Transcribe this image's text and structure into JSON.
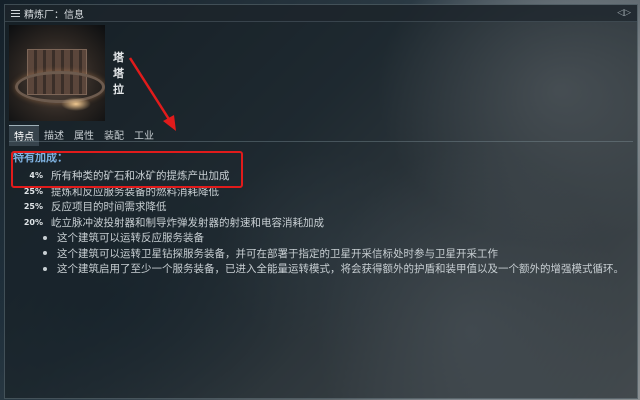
{
  "window": {
    "title": "精炼厂：信息"
  },
  "item": {
    "name": "塔塔拉"
  },
  "tabs": [
    {
      "label": "特点",
      "active": true
    },
    {
      "label": "描述"
    },
    {
      "label": "属性"
    },
    {
      "label": "装配"
    },
    {
      "label": "工业"
    }
  ],
  "traits": {
    "section_title": "特有加成：",
    "bonuses": [
      {
        "value": "4%",
        "text": "所有种类的矿石和冰矿的提炼产出加成"
      },
      {
        "value": "25%",
        "text": "提炼和反应服务装备的燃料消耗降低"
      },
      {
        "value": "25%",
        "text": "反应项目的时间需求降低"
      },
      {
        "value": "20%",
        "text": "屹立脉冲波投射器和制导炸弹发射器的射速和电容消耗加成"
      }
    ],
    "notes": [
      "这个建筑可以运转反应服务装备",
      "这个建筑可以运转卫星钻探服务装备，并可在部署于指定的卫星开采信标处时参与卫星开采工作",
      "这个建筑启用了至少一个服务装备，已进入全能量运转模式，将会获得额外的护盾和装甲值以及一个额外的增强模式循环。"
    ]
  },
  "colors": {
    "highlight_box": "#e11b1b",
    "section_title": "#7fb2e0"
  },
  "icons": [
    "menu-icon",
    "collapse-icon"
  ]
}
